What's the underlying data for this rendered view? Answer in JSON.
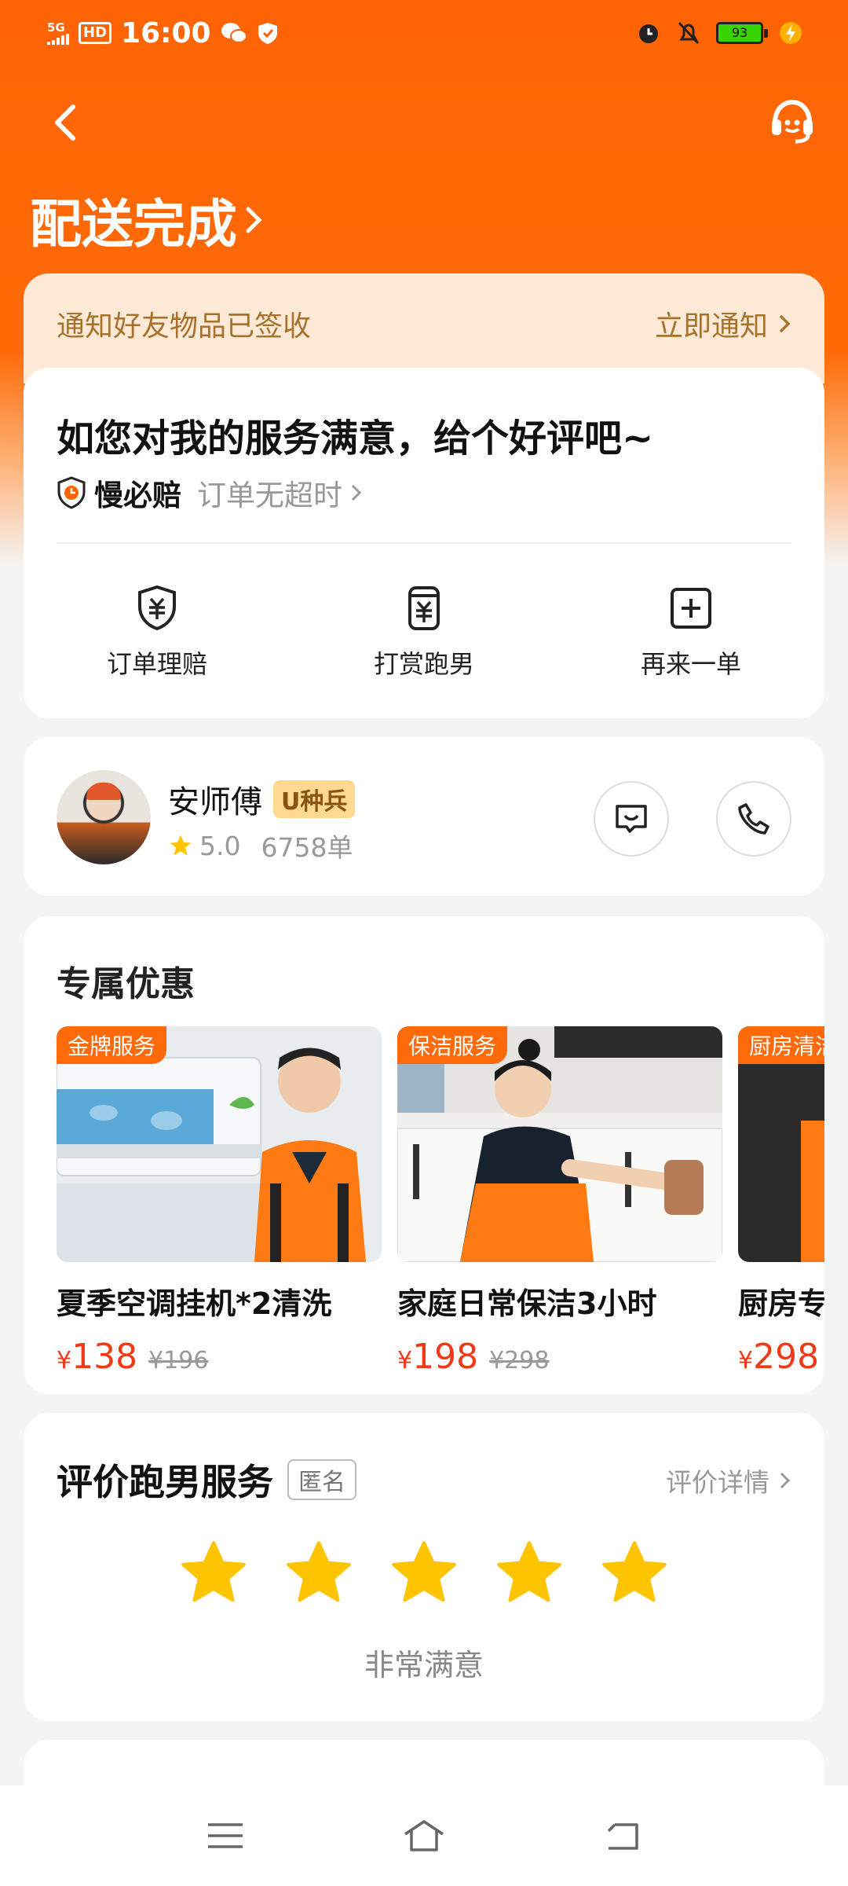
{
  "status_bar": {
    "network": "5G",
    "hd": "HD",
    "time": "16:00",
    "battery": "93"
  },
  "header": {
    "title": "配送完成"
  },
  "notify": {
    "text": "通知好友物品已签收",
    "action": "立即通知"
  },
  "review_card": {
    "title": "如您对我的服务满意，给个好评吧~",
    "guarantee_name": "慢必赔",
    "guarantee_desc": "订单无超时",
    "actions": [
      {
        "label": "订单理赔",
        "icon": "claim-shield-icon"
      },
      {
        "label": "打赏跑男",
        "icon": "tip-cup-icon"
      },
      {
        "label": "再来一单",
        "icon": "reorder-plus-icon"
      }
    ]
  },
  "rider": {
    "name": "安师傅",
    "badge": "U种兵",
    "rating": "5.0",
    "orders": "6758单"
  },
  "deals": {
    "title": "专属优惠",
    "items": [
      {
        "tag": "金牌服务",
        "name": "夏季空调挂机*2清洗",
        "yen": "¥",
        "price": "138",
        "old_price": "¥196"
      },
      {
        "tag": "保洁服务",
        "name": "家庭日常保洁3小时",
        "yen": "¥",
        "price": "198",
        "old_price": "¥298"
      },
      {
        "tag": "厨房清洁",
        "name": "厨房专项清洁",
        "yen": "¥",
        "price": "298",
        "old_price": ""
      }
    ]
  },
  "rating_section": {
    "title": "评价跑男服务",
    "anonymous": "匿名",
    "detail": "评价详情",
    "stars": 5,
    "result": "非常满意"
  },
  "colors": {
    "brand": "#ff6404",
    "price": "#f03a17",
    "star": "#ffc400"
  }
}
